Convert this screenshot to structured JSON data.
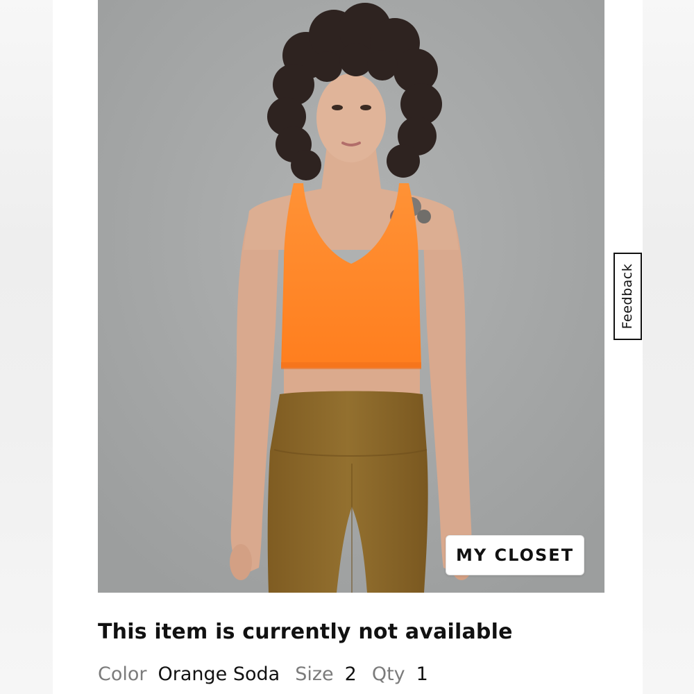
{
  "product": {
    "image_alt": "Model wearing orange cropped tank and brown leggings",
    "colors": {
      "background": "#a4a6a6",
      "top": "#ff8a2a",
      "leggings": "#8f6a2c"
    }
  },
  "buttons": {
    "my_closet": "MY CLOSET",
    "feedback": "Feedback"
  },
  "status": {
    "message": "This item is currently not available"
  },
  "details": {
    "color_label": "Color",
    "color_value": "Orange Soda",
    "size_label": "Size",
    "size_value": "2",
    "qty_label": "Qty",
    "qty_value": "1"
  }
}
